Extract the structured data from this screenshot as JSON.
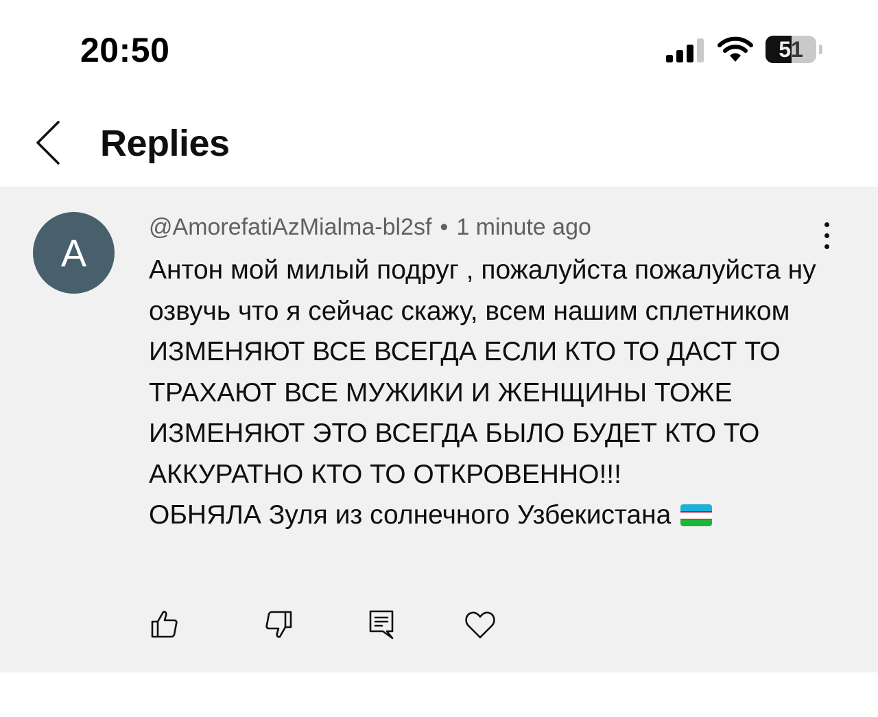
{
  "status_bar": {
    "time": "20:50",
    "battery_level": "51",
    "battery_fraction": 0.51,
    "icons": [
      "cellular-signal-icon",
      "wifi-icon",
      "battery-icon"
    ]
  },
  "header": {
    "title": "Replies",
    "back_icon": "chevron-left-icon"
  },
  "comment": {
    "avatar_letter": "A",
    "avatar_color": "#48606b",
    "author": "@AmorefatiAzMialma-bl2sf",
    "separator": "•",
    "time_ago": "1 minute ago",
    "text": "Антон мой милый подруг , пожалуйста пожалуйста ну озвучь что я сейчас скажу, всем нашим сплетником ИЗМЕНЯЮТ ВСЕ ВСЕГДА ЕСЛИ КТО ТО ДАСТ ТО ТРАХАЮТ ВСЕ МУЖИКИ И ЖЕНЩИНЫ ТОЖЕ ИЗМЕНЯЮТ ЭТО ВСЕГДА БЫЛО БУДЕТ КТО ТО АККУРАТНО КТО ТО ОТКРОВЕННО!!!",
    "text_line2": "ОБНЯЛА Зуля из солнечного Узбекистана",
    "emoji": "uzbekistan-flag-icon"
  },
  "actions": {
    "icons": [
      "thumbs-up-icon",
      "thumbs-down-icon",
      "reply-icon",
      "heart-icon"
    ]
  },
  "colors": {
    "card_background": "#f1f1f1",
    "meta_text": "#606060",
    "primary_text": "#0f0f0f"
  }
}
